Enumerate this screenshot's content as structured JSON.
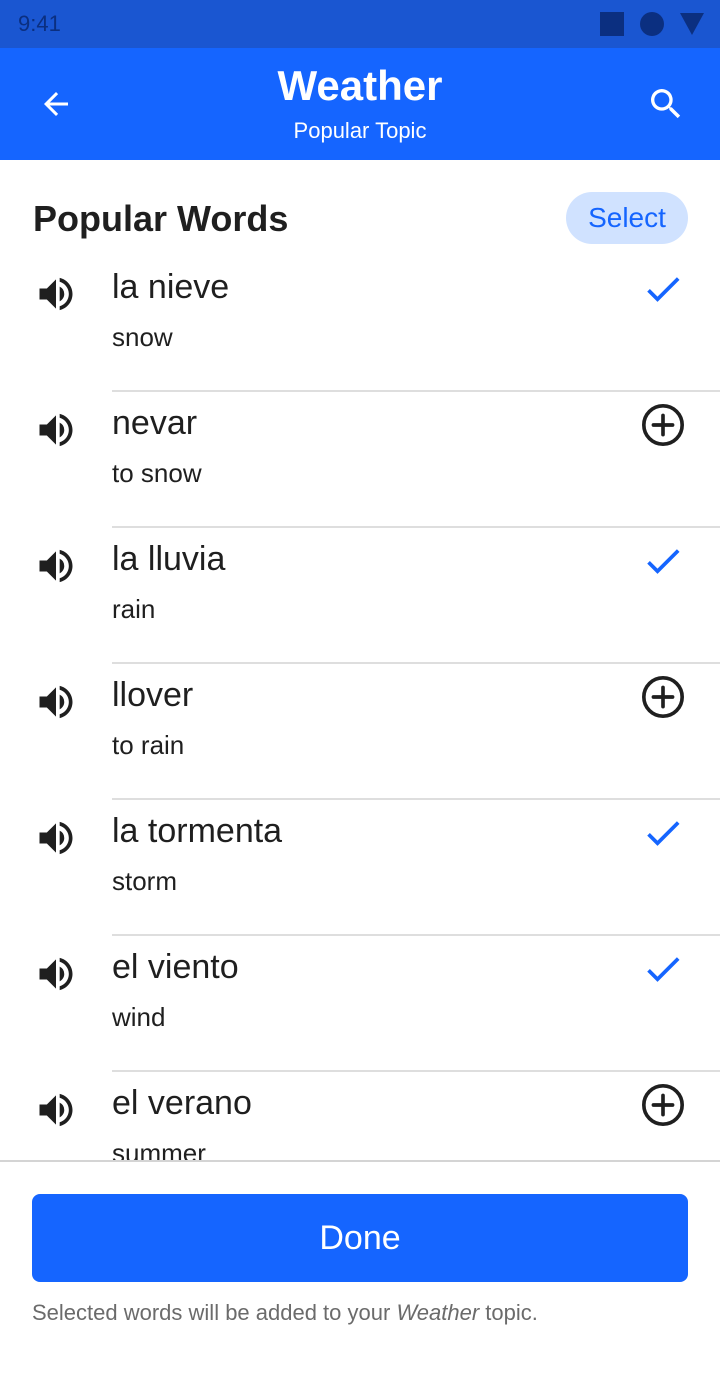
{
  "status_bar": {
    "time": "9:41",
    "icons": [
      "square-icon",
      "circle-icon",
      "triangle-icon"
    ]
  },
  "app_bar": {
    "title": "Weather",
    "subtitle": "Popular Topic",
    "back_icon": "arrow-left-icon",
    "search_icon": "search-icon"
  },
  "section": {
    "title": "Popular Words",
    "select_label": "Select"
  },
  "words": [
    {
      "term": "la nieve",
      "meaning": "snow",
      "added": true
    },
    {
      "term": "nevar",
      "meaning": "to snow",
      "added": false
    },
    {
      "term": "la lluvia",
      "meaning": "rain",
      "added": true
    },
    {
      "term": "llover",
      "meaning": "to rain",
      "added": false
    },
    {
      "term": "la tormenta",
      "meaning": "storm",
      "added": true
    },
    {
      "term": "el viento",
      "meaning": "wind",
      "added": true
    },
    {
      "term": "el verano",
      "meaning": "summer",
      "added": false
    }
  ],
  "footer": {
    "done_label": "Done",
    "note_prefix": "Selected words will be added to your ",
    "note_topic": "Weather",
    "note_suffix": " topic."
  },
  "colors": {
    "primary": "#1565ff",
    "status_bar": "#1a56d1",
    "select_bg": "#d0e2ff",
    "check": "#1565ff"
  }
}
